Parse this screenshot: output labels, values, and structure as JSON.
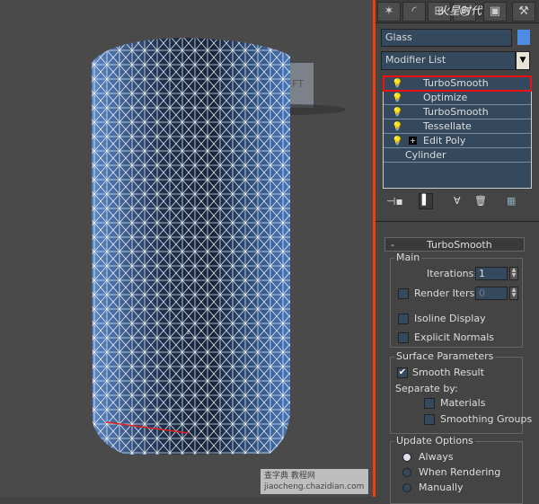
{
  "viewport": {
    "label": "LEFT",
    "axis": "z",
    "background": "#4a4a4a",
    "mesh_color": "#3a5f95"
  },
  "watermarks": {
    "top": "火星时代 www.hxsd.com",
    "bottom": "查字典 教程网 jiaocheng.chazidian.com"
  },
  "panel": {
    "tabs": [
      "create-icon",
      "modify-icon",
      "hierarchy-icon",
      "motion-icon",
      "display-icon",
      "utilities-icon"
    ],
    "object_name": "Glass",
    "object_color": "#4d8ce0",
    "modifier_list": "Modifier List",
    "stack": [
      {
        "label": "TurboSmooth",
        "selected": true,
        "bulb": true
      },
      {
        "label": "Optimize",
        "bulb": true
      },
      {
        "label": "TurboSmooth",
        "bulb": true
      },
      {
        "label": "Tessellate",
        "bulb": true
      },
      {
        "label": "Edit Poly",
        "bulb": true,
        "expand": "+"
      },
      {
        "label": "Cylinder"
      }
    ],
    "rollout": {
      "collapse": "-",
      "title": "TurboSmooth",
      "main": {
        "title": "Main",
        "iterations_label": "Iterations:",
        "iterations": "1",
        "render_iters_label": "Render Iters:",
        "render_iters": "0",
        "render_iters_checked": false,
        "isoline": "Isoline Display",
        "isoline_checked": false,
        "explicit": "Explicit Normals",
        "explicit_checked": false
      },
      "surface": {
        "title": "Surface Parameters",
        "smooth": "Smooth Result",
        "smooth_checked": true,
        "separate": "Separate by:",
        "materials": "Materials",
        "smoothing_groups": "Smoothing Groups"
      },
      "update": {
        "title": "Update Options",
        "always": "Always",
        "when_rendering": "When Rendering",
        "manually": "Manually",
        "selected": "Always"
      }
    }
  }
}
